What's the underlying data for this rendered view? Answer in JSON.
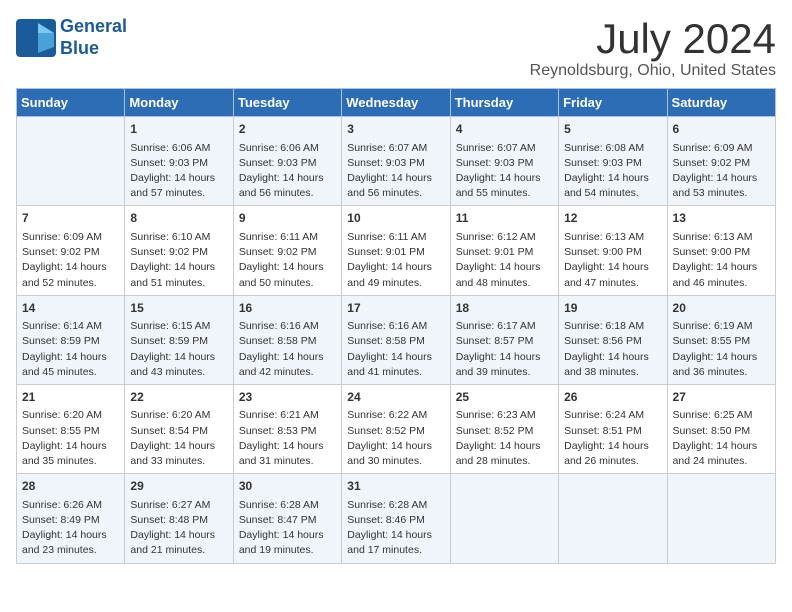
{
  "header": {
    "logo_line1": "General",
    "logo_line2": "Blue",
    "month_year": "July 2024",
    "location": "Reynoldsburg, Ohio, United States"
  },
  "weekdays": [
    "Sunday",
    "Monday",
    "Tuesday",
    "Wednesday",
    "Thursday",
    "Friday",
    "Saturday"
  ],
  "weeks": [
    [
      {
        "day": "",
        "info": ""
      },
      {
        "day": "1",
        "info": "Sunrise: 6:06 AM\nSunset: 9:03 PM\nDaylight: 14 hours\nand 57 minutes."
      },
      {
        "day": "2",
        "info": "Sunrise: 6:06 AM\nSunset: 9:03 PM\nDaylight: 14 hours\nand 56 minutes."
      },
      {
        "day": "3",
        "info": "Sunrise: 6:07 AM\nSunset: 9:03 PM\nDaylight: 14 hours\nand 56 minutes."
      },
      {
        "day": "4",
        "info": "Sunrise: 6:07 AM\nSunset: 9:03 PM\nDaylight: 14 hours\nand 55 minutes."
      },
      {
        "day": "5",
        "info": "Sunrise: 6:08 AM\nSunset: 9:03 PM\nDaylight: 14 hours\nand 54 minutes."
      },
      {
        "day": "6",
        "info": "Sunrise: 6:09 AM\nSunset: 9:02 PM\nDaylight: 14 hours\nand 53 minutes."
      }
    ],
    [
      {
        "day": "7",
        "info": "Sunrise: 6:09 AM\nSunset: 9:02 PM\nDaylight: 14 hours\nand 52 minutes."
      },
      {
        "day": "8",
        "info": "Sunrise: 6:10 AM\nSunset: 9:02 PM\nDaylight: 14 hours\nand 51 minutes."
      },
      {
        "day": "9",
        "info": "Sunrise: 6:11 AM\nSunset: 9:02 PM\nDaylight: 14 hours\nand 50 minutes."
      },
      {
        "day": "10",
        "info": "Sunrise: 6:11 AM\nSunset: 9:01 PM\nDaylight: 14 hours\nand 49 minutes."
      },
      {
        "day": "11",
        "info": "Sunrise: 6:12 AM\nSunset: 9:01 PM\nDaylight: 14 hours\nand 48 minutes."
      },
      {
        "day": "12",
        "info": "Sunrise: 6:13 AM\nSunset: 9:00 PM\nDaylight: 14 hours\nand 47 minutes."
      },
      {
        "day": "13",
        "info": "Sunrise: 6:13 AM\nSunset: 9:00 PM\nDaylight: 14 hours\nand 46 minutes."
      }
    ],
    [
      {
        "day": "14",
        "info": "Sunrise: 6:14 AM\nSunset: 8:59 PM\nDaylight: 14 hours\nand 45 minutes."
      },
      {
        "day": "15",
        "info": "Sunrise: 6:15 AM\nSunset: 8:59 PM\nDaylight: 14 hours\nand 43 minutes."
      },
      {
        "day": "16",
        "info": "Sunrise: 6:16 AM\nSunset: 8:58 PM\nDaylight: 14 hours\nand 42 minutes."
      },
      {
        "day": "17",
        "info": "Sunrise: 6:16 AM\nSunset: 8:58 PM\nDaylight: 14 hours\nand 41 minutes."
      },
      {
        "day": "18",
        "info": "Sunrise: 6:17 AM\nSunset: 8:57 PM\nDaylight: 14 hours\nand 39 minutes."
      },
      {
        "day": "19",
        "info": "Sunrise: 6:18 AM\nSunset: 8:56 PM\nDaylight: 14 hours\nand 38 minutes."
      },
      {
        "day": "20",
        "info": "Sunrise: 6:19 AM\nSunset: 8:55 PM\nDaylight: 14 hours\nand 36 minutes."
      }
    ],
    [
      {
        "day": "21",
        "info": "Sunrise: 6:20 AM\nSunset: 8:55 PM\nDaylight: 14 hours\nand 35 minutes."
      },
      {
        "day": "22",
        "info": "Sunrise: 6:20 AM\nSunset: 8:54 PM\nDaylight: 14 hours\nand 33 minutes."
      },
      {
        "day": "23",
        "info": "Sunrise: 6:21 AM\nSunset: 8:53 PM\nDaylight: 14 hours\nand 31 minutes."
      },
      {
        "day": "24",
        "info": "Sunrise: 6:22 AM\nSunset: 8:52 PM\nDaylight: 14 hours\nand 30 minutes."
      },
      {
        "day": "25",
        "info": "Sunrise: 6:23 AM\nSunset: 8:52 PM\nDaylight: 14 hours\nand 28 minutes."
      },
      {
        "day": "26",
        "info": "Sunrise: 6:24 AM\nSunset: 8:51 PM\nDaylight: 14 hours\nand 26 minutes."
      },
      {
        "day": "27",
        "info": "Sunrise: 6:25 AM\nSunset: 8:50 PM\nDaylight: 14 hours\nand 24 minutes."
      }
    ],
    [
      {
        "day": "28",
        "info": "Sunrise: 6:26 AM\nSunset: 8:49 PM\nDaylight: 14 hours\nand 23 minutes."
      },
      {
        "day": "29",
        "info": "Sunrise: 6:27 AM\nSunset: 8:48 PM\nDaylight: 14 hours\nand 21 minutes."
      },
      {
        "day": "30",
        "info": "Sunrise: 6:28 AM\nSunset: 8:47 PM\nDaylight: 14 hours\nand 19 minutes."
      },
      {
        "day": "31",
        "info": "Sunrise: 6:28 AM\nSunset: 8:46 PM\nDaylight: 14 hours\nand 17 minutes."
      },
      {
        "day": "",
        "info": ""
      },
      {
        "day": "",
        "info": ""
      },
      {
        "day": "",
        "info": ""
      }
    ]
  ]
}
